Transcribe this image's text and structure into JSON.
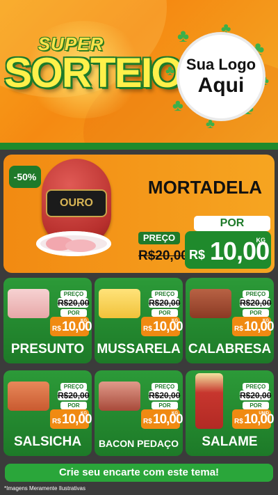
{
  "header": {
    "brand_super": "SUPER",
    "brand_sorteio": "SORTEIO",
    "logo_line1": "Sua Logo",
    "logo_line2": "Aqui"
  },
  "featured": {
    "discount": "-50%",
    "brand_label": "OURO",
    "name": "MORTADELA",
    "preco_label": "PREÇO",
    "old_price": "R$20,00",
    "por_label": "POR",
    "currency": "R$",
    "new_price": "10,00",
    "unit": "KG"
  },
  "products": [
    {
      "name": "PRESUNTO",
      "preco_label": "PREÇO",
      "old_price": "R$20,00",
      "por_label": "POR",
      "currency": "R$",
      "new_price": "10,00",
      "unit": "KG"
    },
    {
      "name": "MUSSARELA",
      "preco_label": "PREÇO",
      "old_price": "R$20,00",
      "por_label": "POR",
      "currency": "R$",
      "new_price": "10,00",
      "unit": "KG"
    },
    {
      "name": "CALABRESA",
      "preco_label": "PREÇO",
      "old_price": "R$20,00",
      "por_label": "POR",
      "currency": "R$",
      "new_price": "10,00",
      "unit": "KG"
    },
    {
      "name": "SALSICHA",
      "preco_label": "PREÇO",
      "old_price": "R$20,00",
      "por_label": "POR",
      "currency": "R$",
      "new_price": "10,00",
      "unit": "KG"
    },
    {
      "name": "BACON PEDAÇO",
      "preco_label": "PREÇO",
      "old_price": "R$20,00",
      "por_label": "POR",
      "currency": "R$",
      "new_price": "10,00",
      "unit": "KG"
    },
    {
      "name": "SALAME",
      "preco_label": "PREÇO",
      "old_price": "R$20,00",
      "por_label": "POR",
      "currency": "R$",
      "new_price": "10,00",
      "unit": "UNID"
    }
  ],
  "footer": {
    "cta": "Crie seu encarte com este tema!",
    "disclaimer": "*Imagens Meramente Ilustrativas"
  },
  "colors": {
    "orange": "#f28a12",
    "green": "#1f8a2c",
    "yellow": "#fff04a"
  }
}
